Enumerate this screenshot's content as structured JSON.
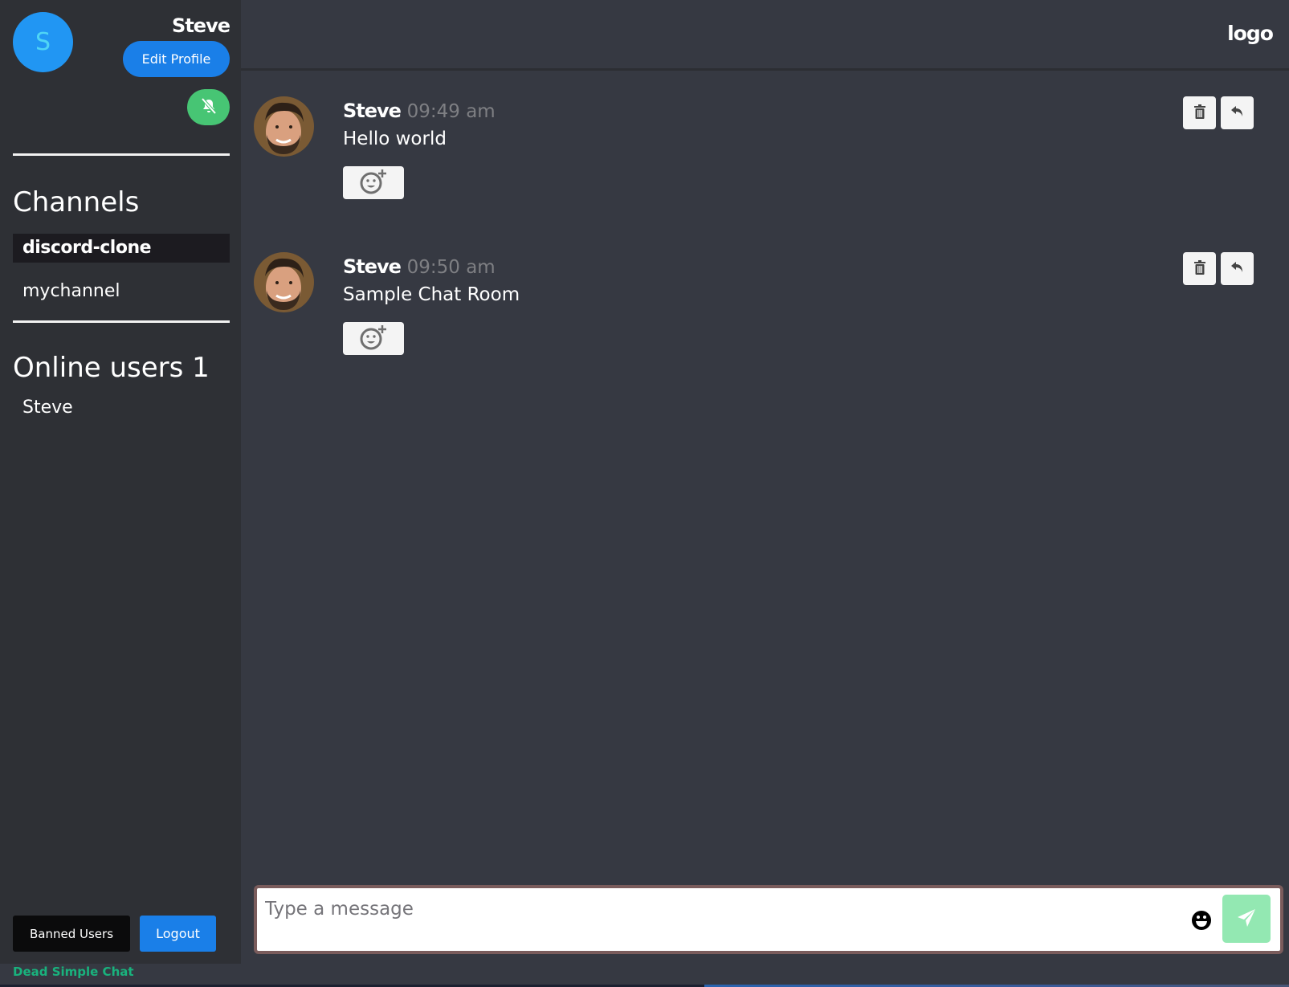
{
  "app": {
    "brand": "Dead Simple Chat",
    "logo": "logo"
  },
  "colors": {
    "accent": "#1a7fe8",
    "notify_toggle": "#47c574",
    "send_button": "#93e8b2",
    "brand": "#19b27d"
  },
  "profile": {
    "avatar_initial": "S",
    "name": "Steve",
    "edit_label": "Edit Profile",
    "notifications_icon": "bell-slash-icon"
  },
  "channels": {
    "heading": "Channels",
    "items": [
      {
        "label": "discord-clone",
        "active": true
      },
      {
        "label": "mychannel",
        "active": false
      }
    ]
  },
  "online": {
    "heading": "Online users 1",
    "users": [
      "Steve"
    ]
  },
  "sidebar_footer": {
    "banned_label": "Banned Users",
    "logout_label": "Logout"
  },
  "messages": [
    {
      "author": "Steve",
      "time": "09:49 am",
      "text": "Hello world"
    },
    {
      "author": "Steve",
      "time": "09:50 am",
      "text": "Sample Chat Room"
    }
  ],
  "composer": {
    "placeholder": "Type a message",
    "value": ""
  }
}
